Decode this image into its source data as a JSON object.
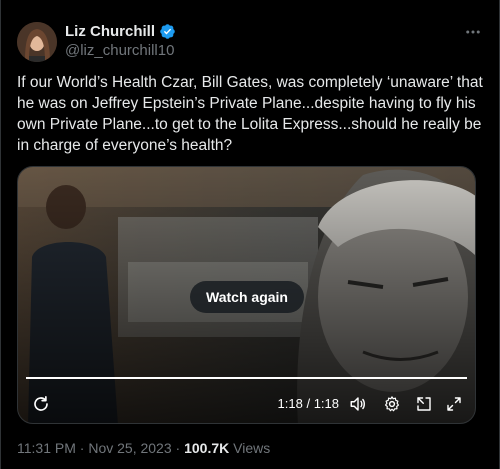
{
  "tweet": {
    "display_name": "Liz Churchill",
    "handle": "@liz_churchill10",
    "text": "If our World’s Health Czar, Bill Gates, was completely ‘unaware’ that he was on Jeffrey Epstein’s Private Plane...despite having to fly his own Private Plane...to get to the Lolita Express...should he really be in charge of everyone’s health?",
    "time": "11:31 PM",
    "separator": "·",
    "date": "Nov 25, 2023",
    "views_count": "100.7K",
    "views_label": "Views"
  },
  "video": {
    "watch_again_label": "Watch again",
    "current_time": "1:18",
    "time_separator": "/",
    "duration": "1:18",
    "progress_fraction": 1.0
  },
  "icons": {
    "verified": "verified-badge-icon",
    "more": "more-icon",
    "replay": "replay-icon",
    "volume": "volume-icon",
    "settings": "gear-icon",
    "pip": "picture-in-picture-icon",
    "fullscreen": "fullscreen-icon"
  },
  "colors": {
    "background": "#000000",
    "text": "#e7e9ea",
    "muted": "#71767b",
    "verified": "#1d9bf0",
    "border": "#2f3336"
  }
}
